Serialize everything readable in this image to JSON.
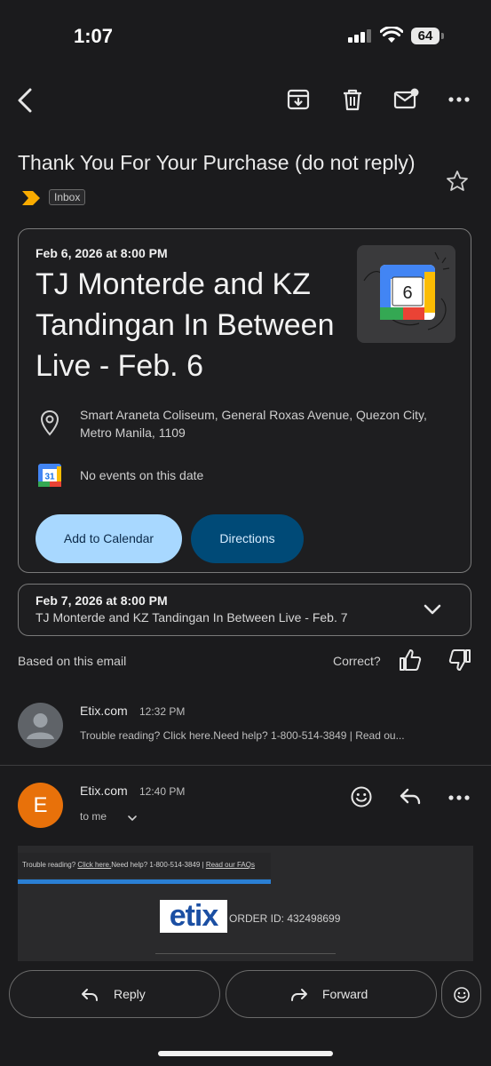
{
  "status_bar": {
    "time": "1:07",
    "battery": "64"
  },
  "subject": "Thank You For Your Purchase (do not reply)",
  "label": "Inbox",
  "event1": {
    "date": "Feb 6, 2026 at 8:00 PM",
    "title": "TJ Monterde and KZ Tandingan In Between Live - Feb. 6",
    "location": "Smart Araneta Coliseum, General Roxas Avenue, Quezon City, Metro Manila, 1109",
    "calendar_status": "No events on this date",
    "calendar_day": "31",
    "thumb_day": "6",
    "add_button": "Add to Calendar",
    "directions_button": "Directions"
  },
  "event2": {
    "date": "Feb 7, 2026 at 8:00 PM",
    "title": "TJ Monterde and KZ Tandingan In Between Live - Feb. 7"
  },
  "based_on": "Based on this email",
  "correct": "Correct?",
  "message1": {
    "sender": "Etix.com",
    "time": "12:32 PM",
    "snippet": "Trouble reading? Click here.Need help? 1-800-514-3849 | Read ou..."
  },
  "message2": {
    "avatar_letter": "E",
    "sender": "Etix.com",
    "time": "12:40 PM",
    "recipient": "to me"
  },
  "email_body": {
    "trouble_prefix": "Trouble reading? ",
    "click_here": "Click here.",
    "need_help": "Need help? 1-800-514-3849 | ",
    "faqs": "Read our FAQs",
    "logo": "etix",
    "order_id": "ORDER ID: 432498699"
  },
  "bottom": {
    "reply": "Reply",
    "forward": "Forward"
  },
  "colors": {
    "background": "#1b1b1d",
    "primary_button": "#a8d8ff",
    "secondary_button": "#004a77",
    "avatar_e": "#e8710a",
    "label_tag": "#f9ab00",
    "etix_blue": "#1b4fa3"
  },
  "icons": [
    "back-arrow-icon",
    "archive-icon",
    "trash-icon",
    "mark-unread-icon",
    "more-icon",
    "star-icon",
    "label-importance-icon",
    "location-pin-icon",
    "google-calendar-icon",
    "chevron-down-icon",
    "thumbs-up-icon",
    "thumbs-down-icon",
    "person-icon",
    "emoji-icon",
    "reply-icon",
    "forward-icon"
  ]
}
